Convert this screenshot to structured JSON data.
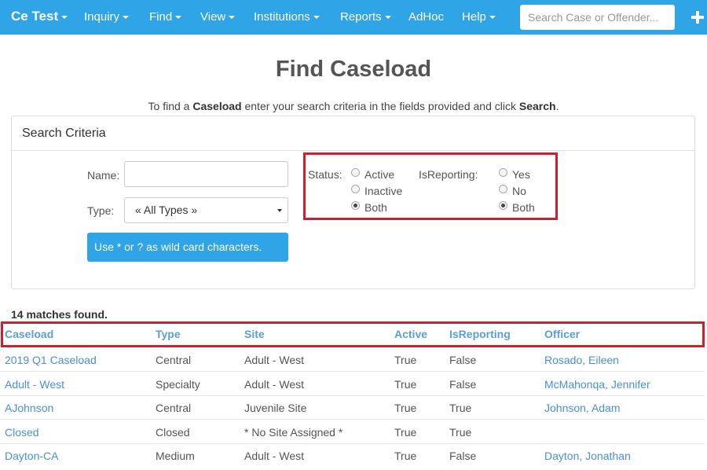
{
  "navbar": {
    "brand": "Ce Test",
    "items": [
      "Inquiry",
      "Find",
      "View",
      "Institutions",
      "Reports",
      "AdHoc",
      "Help"
    ],
    "search_placeholder": "Search Case or Offender..."
  },
  "page": {
    "title": "Find Caseload",
    "instructions": {
      "prefix": "To find a ",
      "entity": "Caseload",
      "middle": " enter your search criteria in the fields provided and click ",
      "action": "Search",
      "suffix": "."
    }
  },
  "search_panel": {
    "heading": "Search Criteria",
    "name_label": "Name:",
    "type_label": "Type:",
    "type_value": "« All Types »",
    "wildcard_button": "Use * or ? as wild card characters.",
    "status_label": "Status:",
    "status_options": [
      "Active",
      "Inactive",
      "Both"
    ],
    "status_selected": "Both",
    "isreporting_label": "IsReporting:",
    "isreporting_options": [
      "Yes",
      "No",
      "Both"
    ],
    "isreporting_selected": "Both"
  },
  "results": {
    "match_count": "14 matches found.",
    "columns": [
      "Caseload",
      "Type",
      "Site",
      "Active",
      "IsReporting",
      "Officer"
    ],
    "rows": [
      [
        "2019 Q1 Caseload",
        "Central",
        "Adult - West",
        "True",
        "False",
        "Rosado, Eileen"
      ],
      [
        "Adult - West",
        "Specialty",
        "Adult - West",
        "True",
        "False",
        "McMahonqa, Jennifer"
      ],
      [
        "AJohnson",
        "Central",
        "Juvenile Site",
        "True",
        "True",
        "Johnson, Adam"
      ],
      [
        "Closed",
        "Closed",
        "* No Site Assigned *",
        "True",
        "True",
        ""
      ],
      [
        "Dayton-CA",
        "Medium",
        "Adult - West",
        "True",
        "False",
        "Dayton, Jonathan"
      ]
    ]
  },
  "colors": {
    "navbar": "#2fa4e7",
    "link": "#4a90d9",
    "highlight_box": "#cc1f2f"
  }
}
